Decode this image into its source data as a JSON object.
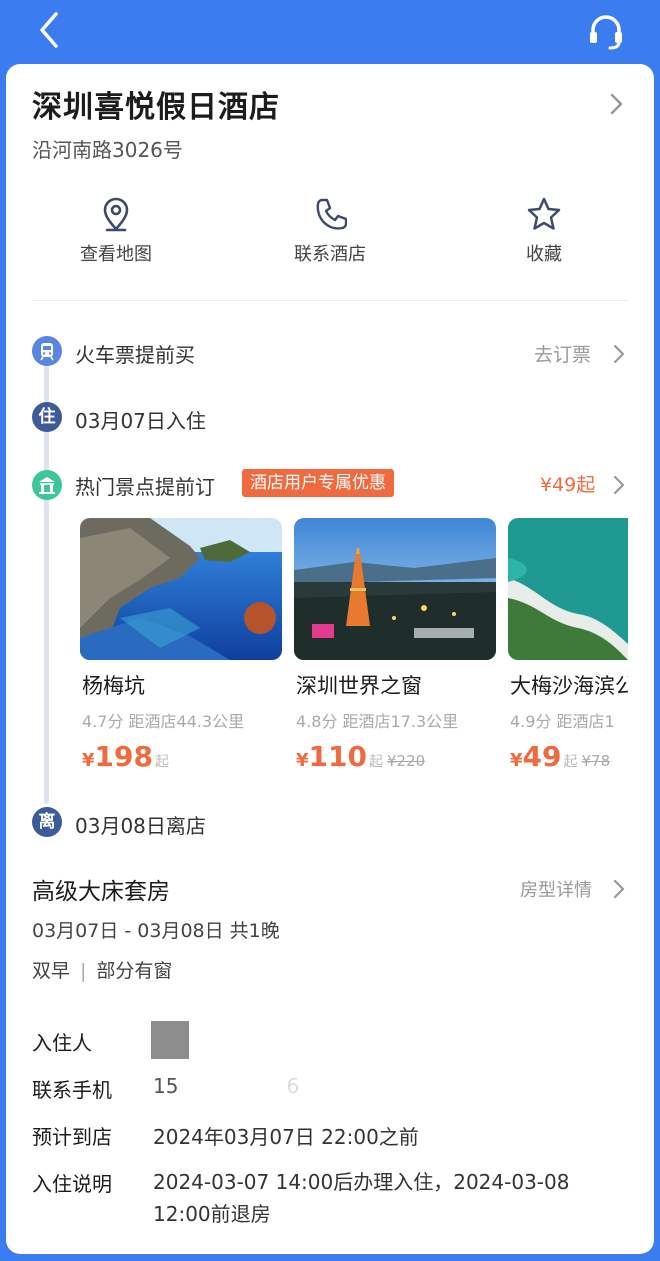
{
  "header": {
    "back_icon": "chevron-left-icon",
    "service_icon": "headset-icon",
    "background": "#3b7cf0"
  },
  "hotel": {
    "name": "深圳喜悦假日酒店",
    "address": "沿河南路3026号"
  },
  "actions": [
    {
      "label": "查看地图",
      "icon": "map-pin-icon"
    },
    {
      "label": "联系酒店",
      "icon": "phone-icon"
    },
    {
      "label": "收藏",
      "icon": "star-icon"
    }
  ],
  "timeline": {
    "train": {
      "icon_text": "",
      "label": "火车票提前买",
      "action": "去订票"
    },
    "checkin": {
      "icon_text": "住",
      "label": "03月07日入住"
    },
    "attractions": {
      "label": "热门景点提前订",
      "tag": "酒店用户专属优惠",
      "price_from": "¥49起"
    },
    "checkout": {
      "icon_text": "离",
      "label": "03月08日离店"
    }
  },
  "attractions": [
    {
      "name": "杨梅坑",
      "meta": "4.7分  距酒店44.3公里",
      "currency": "¥",
      "price": "198",
      "suffix": "起",
      "original": ""
    },
    {
      "name": "深圳世界之窗",
      "meta": "4.8分  距酒店17.3公里",
      "currency": "¥",
      "price": "110",
      "suffix": "起",
      "original": "¥220"
    },
    {
      "name": "大梅沙海滨公",
      "meta": "4.9分  距酒店1",
      "currency": "¥",
      "price": "49",
      "suffix": "起",
      "original": "¥78"
    }
  ],
  "room": {
    "title": "高级大床套房",
    "detail_link": "房型详情",
    "dates": "03月07日 - 03月08日  共1晚",
    "breakfast": "双早",
    "window": "部分有窗"
  },
  "guest_info": {
    "guest_label": "入住人",
    "phone_label": "联系手机",
    "phone_value_start": "15",
    "phone_value_end": "6",
    "arrival_label": "预计到店",
    "arrival_value": "2024年03月07日 22:00之前",
    "note_label": "入住说明",
    "note_value": "2024-03-07 14:00后办理入住，2024-03-08 12:00前退房"
  },
  "colors": {
    "accent": "#3b7cf0",
    "orange": "#f06a3f",
    "timeline_dot": "#3d5a99"
  }
}
